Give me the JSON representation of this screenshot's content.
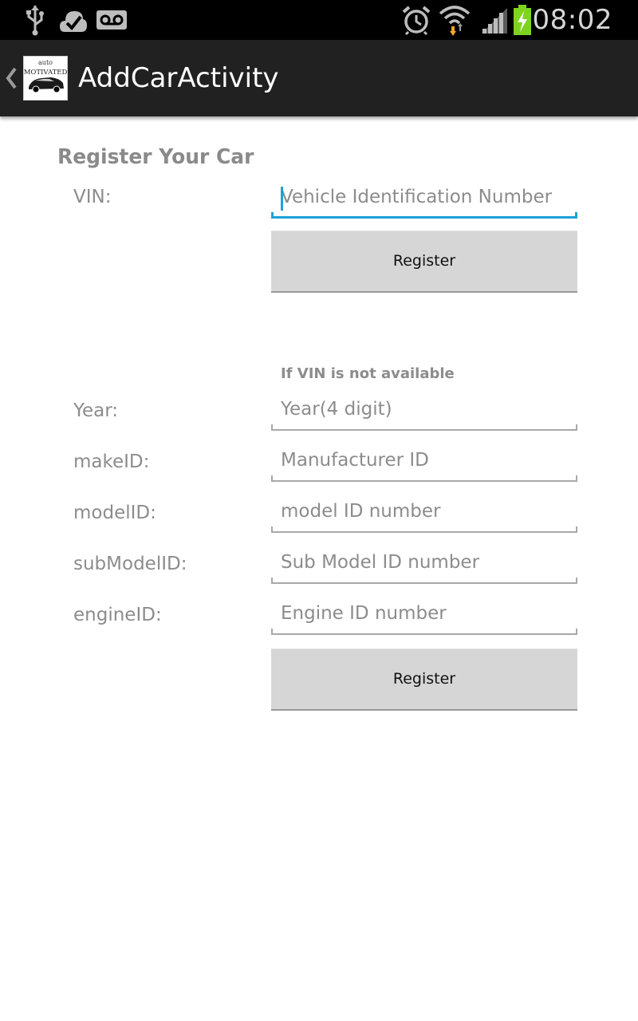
{
  "status_bar": {
    "time": "08:02",
    "icons": [
      "usb-icon",
      "checkmark-cloud-icon",
      "voicemail-icon",
      "alarm-icon",
      "wifi-icon",
      "signal-icon",
      "battery-charging-icon"
    ]
  },
  "action_bar": {
    "title": "AddCarActivity",
    "logo": {
      "top_text": "auto",
      "main_text": "MOTIVATED"
    }
  },
  "form": {
    "heading": "Register Your Car",
    "vin": {
      "label": "VIN:",
      "value": "",
      "placeholder": "Vehicle Identification Number"
    },
    "vin_register_button": "Register",
    "alt_note": "If VIN is not available",
    "fields": [
      {
        "label": "Year:",
        "value": "",
        "placeholder": "Year(4 digit)"
      },
      {
        "label": "makeID:",
        "value": "",
        "placeholder": "Manufacturer ID"
      },
      {
        "label": "modelID:",
        "value": "",
        "placeholder": "model ID number"
      },
      {
        "label": "subModelID:",
        "value": "",
        "placeholder": "Sub Model ID number"
      },
      {
        "label": "engineID:",
        "value": "",
        "placeholder": "Engine ID number"
      }
    ],
    "details_register_button": "Register"
  },
  "colors": {
    "status_bar_bg": "#000000",
    "action_bar_bg": "#212121",
    "focus_accent": "#1da1d8",
    "battery_green": "#7ed321",
    "button_bg": "#d6d6d6",
    "label_gray": "#8c8c8c"
  }
}
